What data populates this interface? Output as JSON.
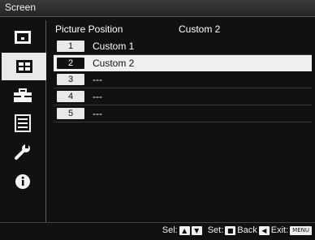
{
  "title": "Screen",
  "sidebar": {
    "icons": [
      "picture-icon",
      "screen-icon",
      "toolbox-icon",
      "list-icon",
      "wrench-icon",
      "info-icon"
    ]
  },
  "content": {
    "col1": "Picture Position",
    "col2": "Custom 2",
    "rows": [
      {
        "num": "1",
        "label": "Custom 1",
        "selected": false
      },
      {
        "num": "2",
        "label": "Custom 2",
        "selected": true
      },
      {
        "num": "3",
        "label": "---",
        "selected": false
      },
      {
        "num": "4",
        "label": "---",
        "selected": false
      },
      {
        "num": "5",
        "label": "---",
        "selected": false
      }
    ]
  },
  "help": {
    "sel": "Sel:",
    "set": "Set:",
    "back": "Back",
    "exit": "Exit:",
    "menu": "MENU"
  }
}
